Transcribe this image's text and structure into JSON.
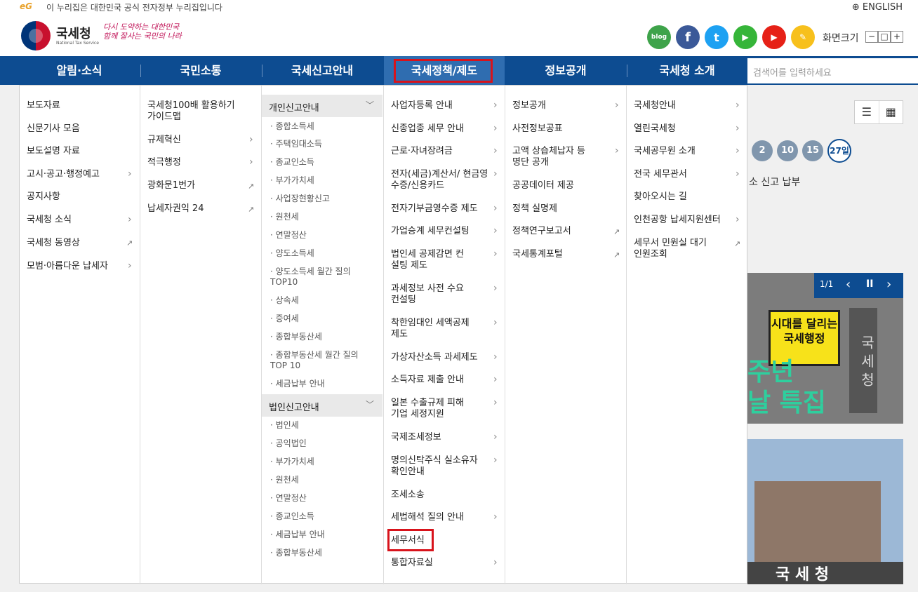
{
  "topbar": {
    "eg_logo": "eG",
    "gov_notice": "이 누리집은 대한민국 공식 전자정부 누리집입니다",
    "english": "ENGLISH"
  },
  "header": {
    "logo_text": "국세청",
    "logo_sub": "National Tax Service",
    "slogan": "다시 도약하는 대한민국 함께 잘사는 국민의 나라",
    "social": [
      "blog",
      "f",
      "t",
      "▶",
      "▶",
      "✎"
    ],
    "fontsize_label": "화면크기",
    "fontsize_btns": [
      "−",
      "□",
      "+"
    ]
  },
  "gnb": {
    "items": [
      "알림·소식",
      "국민소통",
      "국세신고안내",
      "국세정책/제도",
      "정보공개",
      "국세청 소개"
    ],
    "search_placeholder": "검색어를 입력하세요"
  },
  "menu": {
    "col1": [
      "보도자료",
      "신문기사 모음",
      "보도설명 자료",
      "고시·공고·행정예고",
      "공지사항",
      "국세청 소식",
      "국세청 동영상",
      "모범·아름다운 납세자"
    ],
    "col2": [
      "국세청100배 활용하기\n가이드맵",
      "규제혁신",
      "적극행정",
      "광화문1번가",
      "납세자권익 24"
    ],
    "col3": {
      "head1": "개인신고안내",
      "subs1": [
        "종합소득세",
        "주택임대소득",
        "종교인소득",
        "부가가치세",
        "사업장현황신고",
        "원천세",
        "연말정산",
        "양도소득세",
        "양도소득세 월간 질의 TOP10",
        "상속세",
        "증여세",
        "종합부동산세",
        "종합부동산세 월간 질의 TOP 10",
        "세금납부 안내"
      ],
      "head2": "법인신고안내",
      "subs2": [
        "법인세",
        "공익법인",
        "부가가치세",
        "원천세",
        "연말정산",
        "종교인소득",
        "세금납부 안내",
        "종합부동산세"
      ]
    },
    "col4": [
      "사업자등록 안내",
      "신종업종 세무 안내",
      "근로·자녀장려금",
      "전자(세금)계산서/ 현금영수증/신용카드",
      "전자기부금영수증 제도",
      "가업승계 세무컨설팅",
      "법인세 공제감면 컨설팅 제도",
      "과세정보 사전 수요 컨설팅",
      "착한임대인 세액공제 제도",
      "가상자산소득 과세제도",
      "소득자료 제출 안내",
      "일본 수출규제 피해기업 세정지원",
      "국제조세정보",
      "명의신탁주식 실소유자 확인안내",
      "조세소송",
      "세법해석 질의 안내",
      "세무서식",
      "통합자료실"
    ],
    "col5": [
      "정보공개",
      "사전정보공표",
      "고액 상습체납자 등 명단 공개",
      "공공데이터 제공",
      "정책 실명제",
      "정책연구보고서",
      "국세통계포털"
    ],
    "col6": [
      "국세청안내",
      "열린국세청",
      "국세공무원 소개",
      "전국 세무관서",
      "찾아오시는 길",
      "인천공항 납세지원센터",
      "세무서 민원실 대기인원조회"
    ]
  },
  "right": {
    "cal_icons": [
      "list-icon",
      "calendar-icon"
    ],
    "dates": [
      "2",
      "10",
      "15",
      "27일"
    ],
    "notice_text": "소 신고 납부",
    "banner1": {
      "page": "1/1",
      "yellow": "시대를 달리는 국세행정",
      "big": "주년\n날 특집",
      "side": "국 세 청"
    },
    "banner2": {
      "text": "국 세 청"
    }
  },
  "colors": {
    "nav": "#0d4c91",
    "highlight": "#d8131b"
  }
}
